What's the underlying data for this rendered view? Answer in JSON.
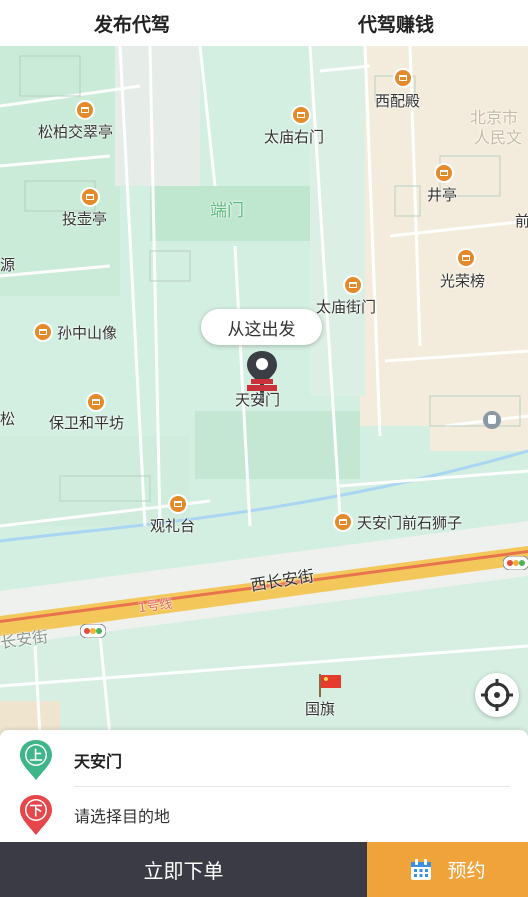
{
  "tabs": [
    {
      "label": "发布代驾"
    },
    {
      "label": "代驾赚钱"
    }
  ],
  "map": {
    "pois": [
      {
        "name": "西配殿"
      },
      {
        "name": "北京市"
      },
      {
        "name": "人民文"
      },
      {
        "name": "松柏交翠亭"
      },
      {
        "name": "太庙右门"
      },
      {
        "name": "井亭"
      },
      {
        "name": "投壶亭"
      },
      {
        "name": "端门"
      },
      {
        "name": "前"
      },
      {
        "name": "源"
      },
      {
        "name": "光荣榜"
      },
      {
        "name": "太庙街门"
      },
      {
        "name": "孙中山像"
      },
      {
        "name": "天安门"
      },
      {
        "name": "松"
      },
      {
        "name": "保卫和平坊"
      },
      {
        "name": "观礼台"
      },
      {
        "name": "天安门前石狮子"
      },
      {
        "name": "西长安街"
      },
      {
        "name": "1号线"
      },
      {
        "name": "长安街"
      },
      {
        "name": "国旗"
      }
    ],
    "bubble": "从这出发"
  },
  "panel": {
    "start_marker": "上",
    "start_value": "天安门",
    "end_marker": "下",
    "end_placeholder": "请选择目的地"
  },
  "actions": {
    "order_label": "立即下单",
    "reserve_label": "预约"
  },
  "colors": {
    "map_bg": "#d7f0e3",
    "accent_orange": "#f0a33a",
    "dark_bar": "#3a3b44",
    "start_green": "#3fb58a",
    "end_red": "#e6474a"
  }
}
